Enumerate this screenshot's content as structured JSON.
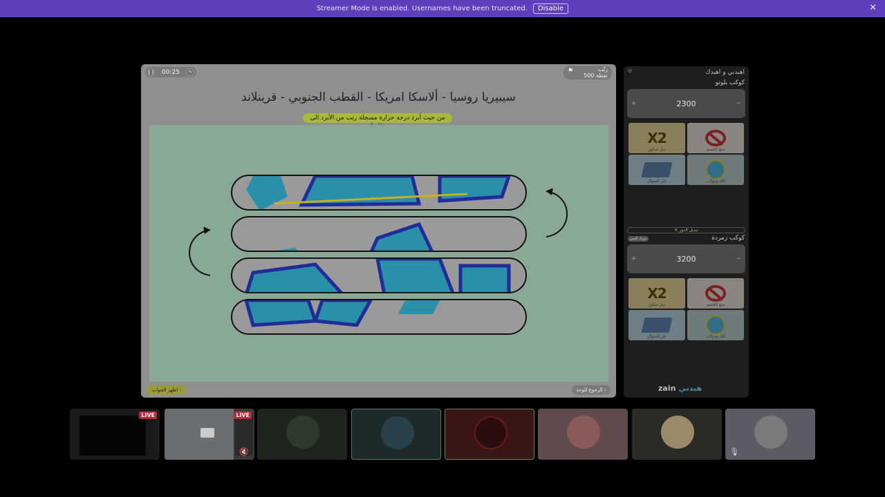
{
  "banner": {
    "message": "Streamer Mode is enabled. Usernames have been truncated.",
    "disable_label": "Disable",
    "close_glyph": "✕"
  },
  "game": {
    "timer": "00:25",
    "rank_label": "رتّب",
    "rank_points": "500 نقطة",
    "question": "سيبيريا روسيا - ألاسكا امريكا - القطب الجنوبي - قرينلاند",
    "subtitle": "من حيث أبرد درجة حرارة مسجلة رتب من الأبرد الى الأدفأ",
    "show_answer": "اظهر الجواب",
    "back_to_board": "الرجوع للوحة"
  },
  "panel": {
    "title": "اهبدني و اهبدك",
    "team1": {
      "name": "كوكب بلوتو",
      "score": "2300"
    },
    "team2": {
      "name": "كوكب زمردة",
      "score": "3200"
    },
    "cards": {
      "x2": "X2",
      "x2_label": "دبل سكور",
      "ban_label": "منع الخصم",
      "swap_label": "غيّر السؤال",
      "wheel_label": "اللد ودولاب"
    },
    "switch_turn": "✕ تبديل الدور",
    "your_turn": "دورك الحين",
    "brand": "zain",
    "brand_ar": "هبدني"
  },
  "tiles": {
    "live1": "LIVE",
    "live2": "LIVE"
  }
}
